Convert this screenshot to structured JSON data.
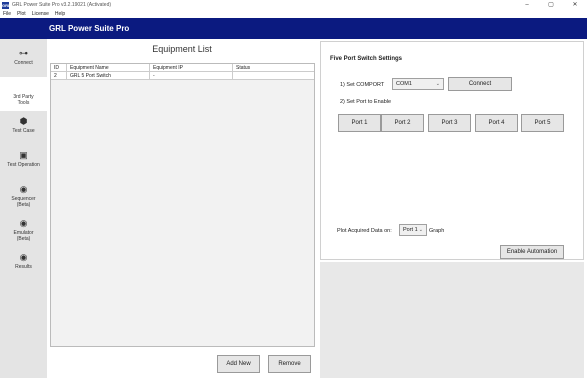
{
  "window": {
    "title": "GRL Power Suite Pro v3.2.19021 (Activated)",
    "icon_text": "GRL",
    "controls": [
      "–",
      "▢",
      "✕"
    ]
  },
  "menu": [
    "File",
    "Plot",
    "License",
    "Help"
  ],
  "header": {
    "title": "GRL Power Suite Pro",
    "bg": "#0b1a80"
  },
  "sidebar": {
    "items": [
      {
        "label": "Connect",
        "icon": "connect-icon",
        "glyph": "⊶"
      },
      {
        "label": "3rd Party Tools",
        "icon": "",
        "glyph": ""
      },
      {
        "label": "Test Case",
        "icon": "cube-icon",
        "glyph": "⬢"
      },
      {
        "label": "Test Operation",
        "icon": "monitor-icon",
        "glyph": "▣"
      },
      {
        "label": "Sequencer (Beta)",
        "icon": "radar-icon",
        "glyph": "◉"
      },
      {
        "label": "Emulator (Beta)",
        "icon": "radar-icon",
        "glyph": "◉"
      },
      {
        "label": "Results",
        "icon": "radar-icon",
        "glyph": "◉"
      }
    ]
  },
  "equipment": {
    "title": "Equipment List",
    "columns": [
      "ID",
      "Equipment Name",
      "Equipment IP",
      "Status"
    ],
    "rows": [
      [
        "2",
        "GRL 5 Port Switch",
        "-",
        ""
      ]
    ],
    "add_label": "Add New",
    "remove_label": "Remove"
  },
  "settings": {
    "title": "Five Port Switch Settings",
    "step1": "1) Set COMPORT",
    "comport_value": "COM1",
    "connect_label": "Connect",
    "step2": "2) Set Port to Enable",
    "ports": [
      "Port 1",
      "Port 2",
      "Port 3",
      "Port 4",
      "Port 5"
    ],
    "plot_label": "Plot Acquired Data on:",
    "plot_value": "Port 1",
    "graph_label": "Graph",
    "enable_label": "Enable Automation"
  }
}
